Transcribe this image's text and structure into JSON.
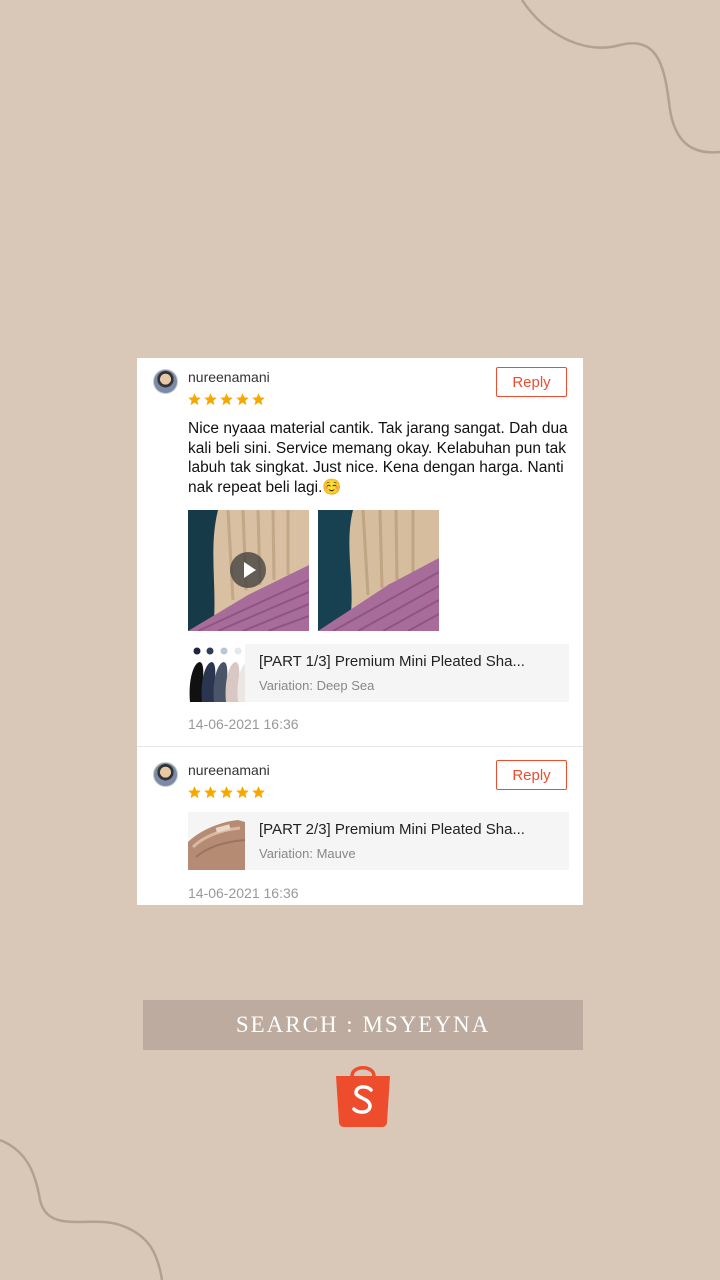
{
  "reviews": [
    {
      "username": "nureenamani",
      "rating": 5,
      "reply_label": "Reply",
      "comment": "Nice nyaaa material cantik. Tak jarang sangat. Dah dua kali beli sini. Service memang okay. Kelabuhan pun tak labuh tak singkat. Just nice. Kena dengan harga. Nanti nak repeat beli lagi.☺️",
      "product_name": "[PART 1/3] Premium Mini Pleated Sha...",
      "variation": "Variation: Deep Sea",
      "date": "14-06-2021 16:36"
    },
    {
      "username": "nureenamani",
      "rating": 5,
      "reply_label": "Reply",
      "product_name": "[PART 2/3] Premium Mini Pleated Sha...",
      "variation": "Variation: Mauve",
      "date": "14-06-2021 16:36"
    }
  ],
  "search_banner": "SEARCH : MSYEYNA",
  "colors": {
    "background": "#d9c8b7",
    "accent": "#ee4d2d",
    "star": "#f6a700",
    "banner": "#bcab9e"
  },
  "icons": [
    "avatar",
    "star-icon",
    "play-icon",
    "shopee-bag-icon"
  ]
}
